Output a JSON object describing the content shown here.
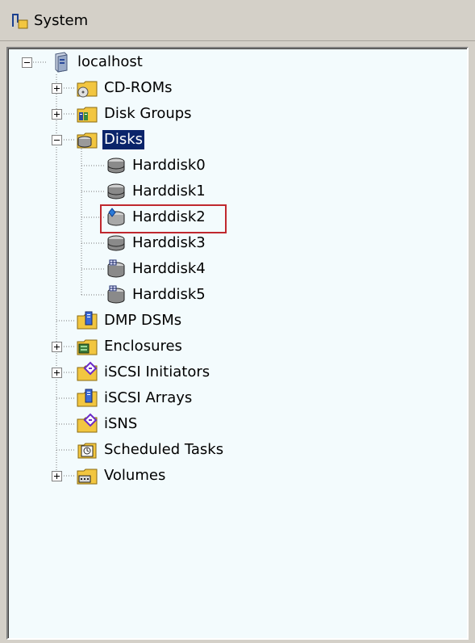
{
  "header": {
    "title": "System",
    "icon": "system-icon"
  },
  "tree": {
    "root": {
      "label": "localhost",
      "icon": "server-icon",
      "expanded": true
    },
    "items": [
      {
        "label": "CD-ROMs",
        "icon": "cdrom-folder-icon",
        "expander": "plus"
      },
      {
        "label": "Disk Groups",
        "icon": "disk-groups-folder-icon",
        "expander": "plus"
      },
      {
        "label": "Disks",
        "icon": "disks-folder-icon",
        "expander": "minus",
        "selected": true
      },
      {
        "label": "Harddisk0",
        "icon": "harddisk-icon"
      },
      {
        "label": "Harddisk1",
        "icon": "harddisk-icon"
      },
      {
        "label": "Harddisk2",
        "icon": "harddisk-blue-icon",
        "highlighted": true
      },
      {
        "label": "Harddisk3",
        "icon": "harddisk-icon"
      },
      {
        "label": "Harddisk4",
        "icon": "harddisk-grid-icon"
      },
      {
        "label": "Harddisk5",
        "icon": "harddisk-grid-icon"
      },
      {
        "label": "DMP DSMs",
        "icon": "dmp-dsms-folder-icon"
      },
      {
        "label": "Enclosures",
        "icon": "enclosures-folder-icon",
        "expander": "plus"
      },
      {
        "label": "iSCSI Initiators",
        "icon": "iscsi-initiators-folder-icon",
        "expander": "plus"
      },
      {
        "label": "iSCSI Arrays",
        "icon": "iscsi-arrays-folder-icon"
      },
      {
        "label": "iSNS",
        "icon": "isns-folder-icon"
      },
      {
        "label": "Scheduled Tasks",
        "icon": "scheduled-tasks-icon"
      },
      {
        "label": "Volumes",
        "icon": "volumes-folder-icon",
        "expander": "plus"
      }
    ]
  },
  "colors": {
    "selection": "#0a246a",
    "highlight_box": "#c0282e",
    "panel_background": "#f3fbfd",
    "folder": "#f2c640"
  }
}
